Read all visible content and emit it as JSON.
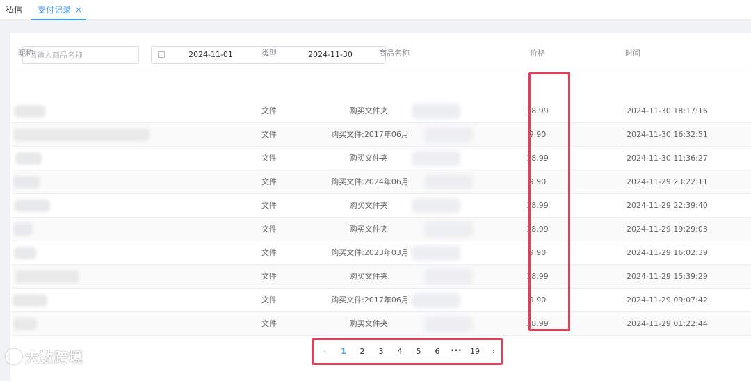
{
  "tabs": [
    {
      "label": "私信"
    },
    {
      "label": "支付记录"
    }
  ],
  "tab_close_glyph": "×",
  "search": {
    "placeholder": "请输入商品名称",
    "value": ""
  },
  "date_range": {
    "start": "2024-11-01",
    "separator": "-",
    "end": "2024-11-30"
  },
  "table": {
    "headers": [
      "昵称",
      "类型",
      "商品名称",
      "价格",
      "时间"
    ],
    "rows": [
      {
        "type": "文件",
        "product": "购买文件夹:",
        "price": "18.99",
        "time": "2024-11-30 18:17:16"
      },
      {
        "type": "文件",
        "product": "购买文件:2017年06月",
        "price": "9.90",
        "time": "2024-11-30 16:32:51"
      },
      {
        "type": "文件",
        "product": "购买文件夹:",
        "price": "18.99",
        "time": "2024-11-30 11:36:27"
      },
      {
        "type": "文件",
        "product": "购买文件:2024年06月",
        "price": "9.90",
        "time": "2024-11-29 23:22:11"
      },
      {
        "type": "文件",
        "product": "购买文件夹:",
        "price": "18.99",
        "time": "2024-11-29 22:39:40"
      },
      {
        "type": "文件",
        "product": "购买文件夹:",
        "price": "18.99",
        "time": "2024-11-29 19:29:03"
      },
      {
        "type": "文件",
        "product": "购买文件:2023年03月",
        "price": "9.90",
        "time": "2024-11-29 16:02:39"
      },
      {
        "type": "文件",
        "product": "购买文件夹:",
        "price": "18.99",
        "time": "2024-11-29 15:39:29"
      },
      {
        "type": "文件",
        "product": "购买文件:2017年06月",
        "price": "9.90",
        "time": "2024-11-29 09:07:42"
      },
      {
        "type": "文件",
        "product": "购买文件夹:",
        "price": "18.99",
        "time": "2024-11-29 01:22:44"
      }
    ]
  },
  "pagination": {
    "prev": "‹",
    "pages": [
      "1",
      "2",
      "3",
      "4",
      "5",
      "6"
    ],
    "ellipsis": "•••",
    "last": "19",
    "next": "›",
    "current": "1"
  },
  "watermark": "大数跨境",
  "colors": {
    "accent": "#409eff",
    "highlight_box": "#e0405a"
  }
}
